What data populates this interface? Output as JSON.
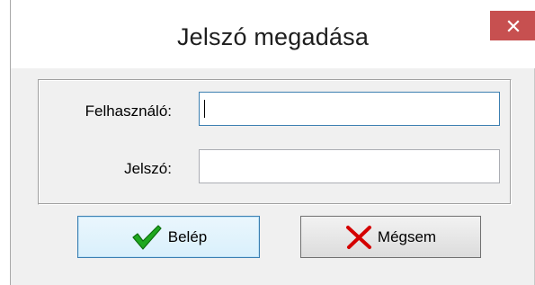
{
  "window": {
    "title": "Jelszó megadása",
    "close_symbol": "×"
  },
  "form": {
    "username_label": "Felhasználó:",
    "username_value": "",
    "password_label": "Jelszó:",
    "password_value": ""
  },
  "buttons": {
    "ok_label": "Belép",
    "ok_icon": "green-checkmark-icon",
    "cancel_label": "Mégsem",
    "cancel_icon": "red-x-icon"
  },
  "colors": {
    "close_button": "#c75050",
    "focus_border": "#3c7fb1",
    "checkmark": "#1fa81f",
    "cross": "#d40000"
  }
}
